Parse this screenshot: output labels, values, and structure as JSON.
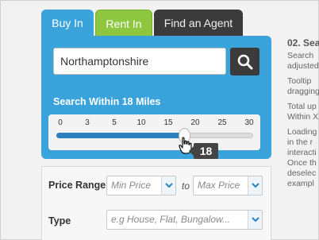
{
  "tabs": [
    {
      "label": "Buy In"
    },
    {
      "label": "Rent In"
    },
    {
      "label": "Find an Agent"
    }
  ],
  "search": {
    "value": "Northamptonshire",
    "button_icon": "magnifier-icon"
  },
  "distance": {
    "label": "Search Within 18 Miles",
    "ticks": [
      "0",
      "3",
      "5",
      "10",
      "15",
      "20",
      "25",
      "30"
    ],
    "value": 18,
    "max": 30,
    "bubble": "18"
  },
  "filters": {
    "price_label": "Price Range",
    "min_placeholder": "Min Price",
    "to_label": "to",
    "max_placeholder": "Max Price",
    "type_label": "Type",
    "type_placeholder": "e.g House, Flat, Bungalow..."
  },
  "side": {
    "heading": "02. Sea",
    "lines": [
      "Search",
      "adjusted",
      "",
      "Tooltip",
      "dragging",
      "",
      "Total up",
      "Within X",
      "",
      "Loading",
      "in the r",
      "interacti",
      "Once th",
      "deselec",
      "exampl"
    ]
  },
  "colors": {
    "buy_tab": "#3aa3dc",
    "rent_tab": "#8dc63f",
    "agent_tab": "#3b3b3b",
    "slider_fill": "#2b82bf"
  }
}
